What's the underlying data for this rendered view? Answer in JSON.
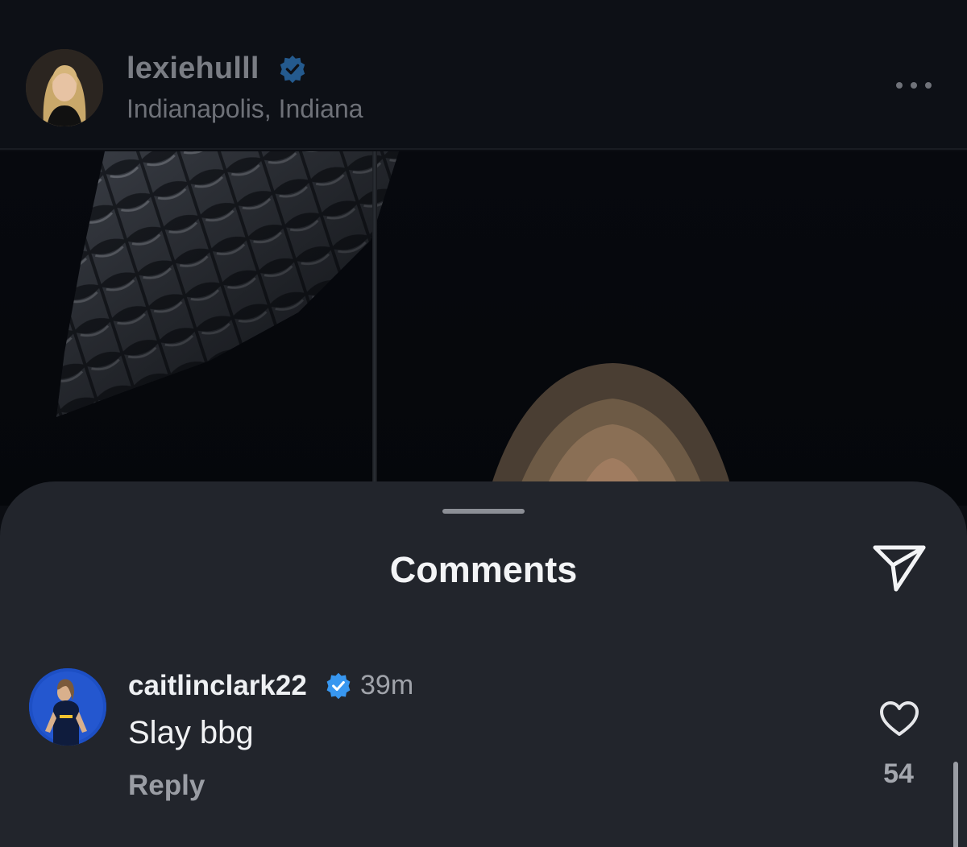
{
  "post": {
    "username": "lexiehulll",
    "location": "Indianapolis, Indiana",
    "verified": true,
    "more_icon": "more-horizontal-icon"
  },
  "comments_sheet": {
    "title": "Comments",
    "share_icon": "send-icon",
    "comments": [
      {
        "username": "caitlinclark22",
        "verified": true,
        "time": "39m",
        "text": "Slay bbg",
        "reply_label": "Reply",
        "like_icon": "heart-icon",
        "like_count": "54"
      }
    ]
  },
  "colors": {
    "background": "#0b0d12",
    "sheet": "#22252c",
    "verified_blue": "#3897f0",
    "text_primary": "#f1f2f4",
    "text_secondary": "#a0a3aa"
  }
}
